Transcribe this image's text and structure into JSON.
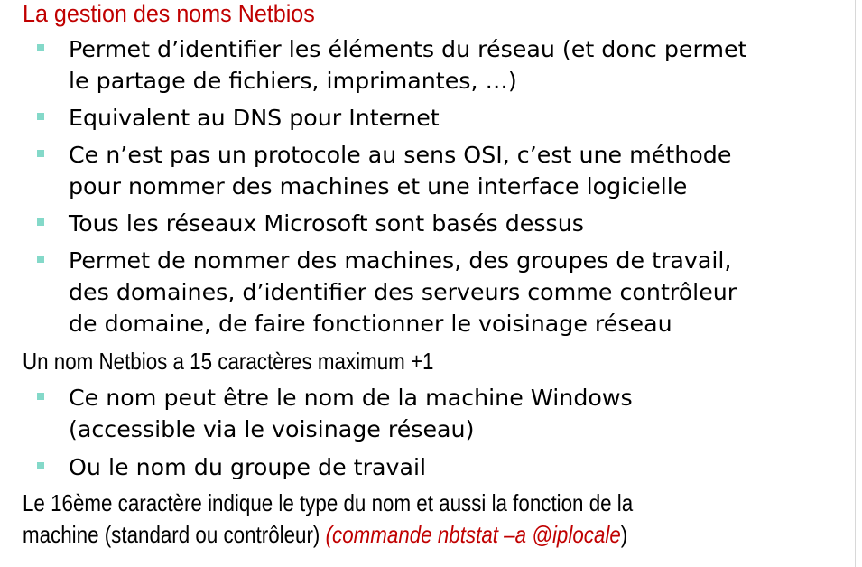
{
  "title": "La gestion des noms Netbios",
  "bullets_1": [
    {
      "lines": [
        "Permet d’identifier les éléments du réseau (et donc permet",
        "le partage de fichiers, imprimantes, …)"
      ]
    },
    {
      "lines": [
        "Equivalent au DNS pour Internet"
      ]
    },
    {
      "lines": [
        "Ce n’est pas un protocole au sens OSI, c’est une méthode",
        "pour nommer des machines et une interface logicielle"
      ]
    },
    {
      "lines": [
        "Tous les réseaux Microsoft sont basés dessus"
      ]
    },
    {
      "lines": [
        "Permet de nommer des machines, des groupes de travail,",
        "des domaines, d’identifier des serveurs comme contrôleur",
        "de domaine, de faire fonctionner le voisinage réseau"
      ]
    }
  ],
  "heading_2": "Un nom Netbios a 15 caractères maximum +1",
  "bullets_2": [
    {
      "lines": [
        "Ce  nom peut être le nom de la machine Windows",
        "(accessible via le voisinage réseau)"
      ]
    },
    {
      "lines": [
        "Ou le nom du groupe de travail"
      ]
    }
  ],
  "footer": {
    "line1": "Le 16ème caractère indique le type du nom et aussi la fonction de la",
    "line2": "machine (standard ou contrôleur) ",
    "command": "(commande nbtstat –a @iplocale",
    "close_paren": ")"
  },
  "colors": {
    "title": "#c00000",
    "bullet": "#84d9c9",
    "command": "#c00000"
  }
}
